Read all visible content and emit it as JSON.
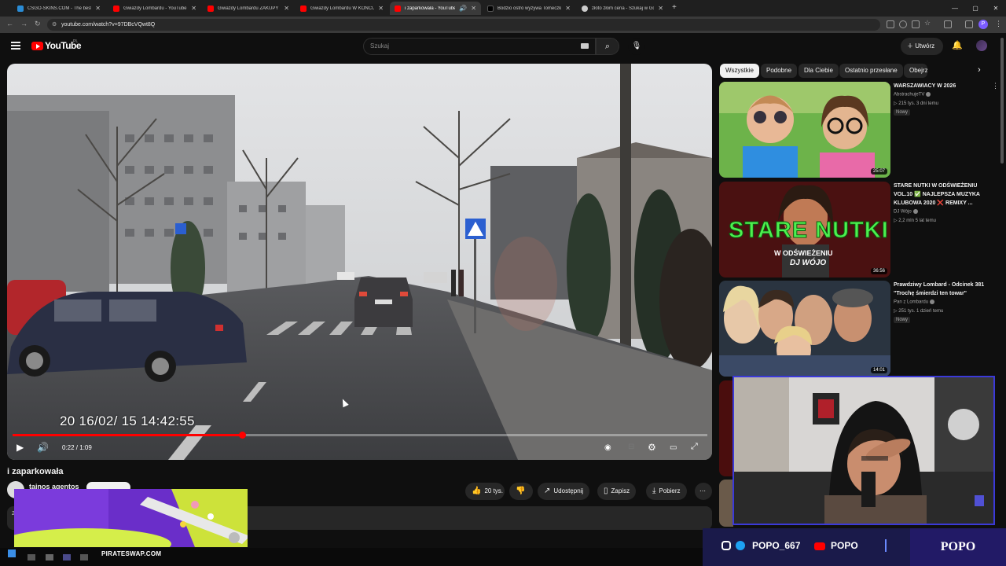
{
  "browser": {
    "tabs": [
      {
        "label": "CSGO-SKINS.COM - The best C",
        "color": "#2a8cd6"
      },
      {
        "label": "Gwiazdy Lombardu - YouTube",
        "color": "#ff0000"
      },
      {
        "label": "Gwiazdy Lombardu ZAKUPY",
        "color": "#ff0000"
      },
      {
        "label": "Gwiazdy Lombardu W KOŃCU",
        "color": "#ff0000"
      },
      {
        "label": "i zaparkowała - YouTube",
        "color": "#ff0000"
      },
      {
        "label": "Bodzio ostro wyzywa Tomeczk",
        "color": "#000000"
      },
      {
        "label": "złoto złom cena - Szukaj w Goo",
        "color": "#cccccc"
      }
    ],
    "new_tab": "+",
    "url": "youtube.com/watch?v=97DBcVQwt8Q",
    "profile_initial": "P"
  },
  "youtube": {
    "logo_text": "YouTube",
    "country": "PL",
    "search_placeholder": "Szukaj",
    "create_label": "Utwórz"
  },
  "player": {
    "timestamp_overlay": "20 16/02/ 15  14:42:55",
    "time_label": "0:22 / 1:09",
    "progress_fraction": 0.33
  },
  "video": {
    "title": "i zaparkowała",
    "channel": "tainos agentos",
    "actions": {
      "likes": "20 tys.",
      "share": "Udostępnij",
      "save": "Zapisz",
      "download": "Pobierz"
    },
    "description_fragment": "2"
  },
  "chips": [
    "Wszystkie",
    "Podobne",
    "Dla Ciebie",
    "Ostatnio przesłane",
    "Obejrz"
  ],
  "recommended": [
    {
      "title": "WARSZAWIACY W 2026",
      "channel": "AbstrachujeTV",
      "meta": "215 tys.  3 dni temu",
      "badge": "Nowy",
      "duration": "25:07"
    },
    {
      "title": "STARE NUTKI W ODŚWIEŻENIU VOL.10 ✅ NAJLEPSZA MUZYKA KLUBOWA 2020 ❌ REMIXY ...",
      "channel": "DJ Wójo",
      "meta": "2,2 mln  5 lat temu",
      "badge": "",
      "duration": "36:56",
      "thumb_text_1": "STARE NUTKI",
      "thumb_text_2": "W ODŚWIEŻENIU",
      "thumb_text_3": "DJ WÓJO"
    },
    {
      "title": "Prawdziwy Lombard - Odcinek 381 \"Trochę śmierdzi ten towar\"",
      "channel": "Pan z Lombardu",
      "meta": "251 tys.  1 dzień temu",
      "badge": "Nowy",
      "duration": "14:01"
    }
  ],
  "ad": {
    "text": "PIRATESWAP.COM"
  },
  "stream": {
    "handle": "POPO_667",
    "youtube": "POPO",
    "brand": "POPO"
  },
  "colors": {
    "youtube_red": "#ff0000",
    "stream_bar": "#1a1a4a",
    "webcam_border": "#3b39d8"
  }
}
